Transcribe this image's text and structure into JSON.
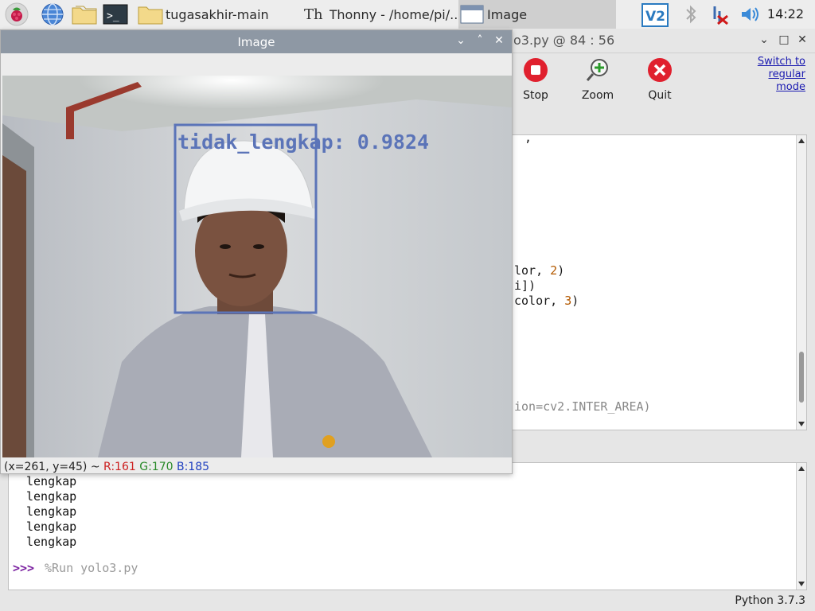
{
  "taskbar": {
    "buttons": [
      {
        "label": "tugasakhir-main",
        "icon": "folder-icon"
      },
      {
        "label": "Thonny  -  /home/pi/...",
        "icon": "thonny-icon"
      },
      {
        "label": "Image",
        "icon": "window-icon"
      }
    ],
    "clock": "14:22"
  },
  "thonny": {
    "title_fragment": "o3.py  @  84 : 56",
    "toolbar": {
      "stop": "Stop",
      "zoom": "Zoom",
      "quit": "Quit"
    },
    "switch_mode": [
      "Switch to",
      "regular",
      "mode"
    ],
    "code": {
      "top_comma": ",",
      "line1_a": "lor, ",
      "line1_num": "2",
      "line1_b": ")",
      "line2": "i])",
      "line3_a": "color, ",
      "line3_num": "3",
      "line3_b": ")",
      "line4": "ion=cv2.INTER_AREA)"
    },
    "shell": {
      "lines": [
        "lengkap",
        "lengkap",
        "lengkap",
        "lengkap",
        "lengkap"
      ],
      "prompt": ">>>",
      "command": "%Run yolo3.py"
    },
    "status": "Python 3.7.3"
  },
  "image_window": {
    "title": "Image",
    "detection_label": "tidak_lengkap: 0.9824",
    "status": {
      "coords": "(x=261, y=45) ~ ",
      "r": "R:161",
      "g": "G:170",
      "b": "B:185"
    }
  }
}
